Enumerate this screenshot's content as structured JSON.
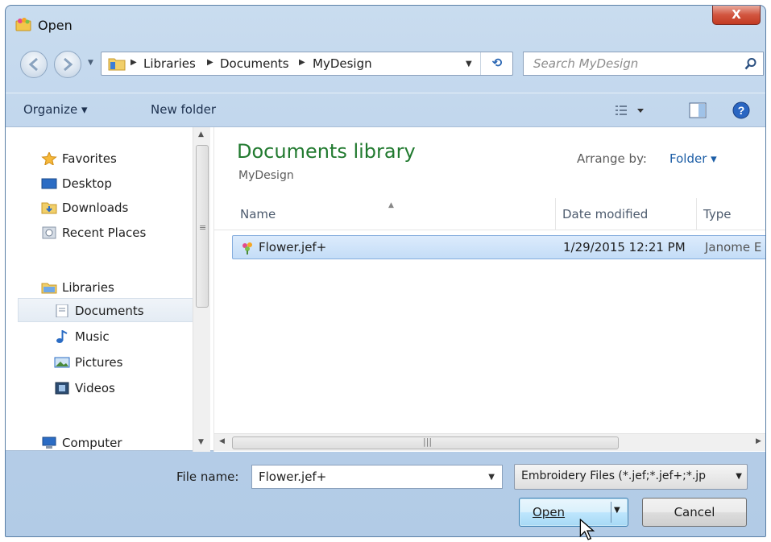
{
  "window": {
    "title": "Open",
    "close_label": "X"
  },
  "address": {
    "crumbs": [
      "Libraries",
      "Documents",
      "MyDesign"
    ],
    "search_placeholder": "Search MyDesign",
    "refresh_label": "⟲"
  },
  "toolbar": {
    "organize": "Organize ▾",
    "new_folder": "New folder"
  },
  "nav": {
    "favorites": "Favorites",
    "desktop": "Desktop",
    "downloads": "Downloads",
    "recent": "Recent Places",
    "libraries": "Libraries",
    "documents": "Documents",
    "music": "Music",
    "pictures": "Pictures",
    "videos": "Videos",
    "computer": "Computer"
  },
  "content": {
    "library_title": "Documents library",
    "library_sub": "MyDesign",
    "arrange_label": "Arrange by:",
    "arrange_value": "Folder ▾",
    "columns": {
      "name": "Name",
      "date": "Date modified",
      "type": "Type"
    },
    "files": [
      {
        "name": "Flower.jef+",
        "date": "1/29/2015 12:21 PM",
        "type": "Janome E"
      }
    ]
  },
  "bottom": {
    "file_name_label": "File name:",
    "file_name_value": "Flower.jef+",
    "filter_value": "Embroidery Files (*.jef;*.jef+;*.jp",
    "open_label": "Open",
    "cancel_label": "Cancel"
  },
  "colors": {
    "accent": "#217a2f",
    "link": "#1d5ea6",
    "selection": "#cce0f8"
  },
  "icons": [
    "open-app-icon",
    "back-icon",
    "forward-icon",
    "folder-icon",
    "refresh-icon",
    "search-icon",
    "view-icon",
    "preview-pane-icon",
    "help-icon",
    "star-icon",
    "desktop-icon",
    "downloads-icon",
    "recent-places-icon",
    "libraries-icon",
    "documents-icon",
    "music-icon",
    "pictures-icon",
    "videos-icon",
    "computer-icon",
    "embroidery-file-icon",
    "mouse-cursor-icon"
  ]
}
